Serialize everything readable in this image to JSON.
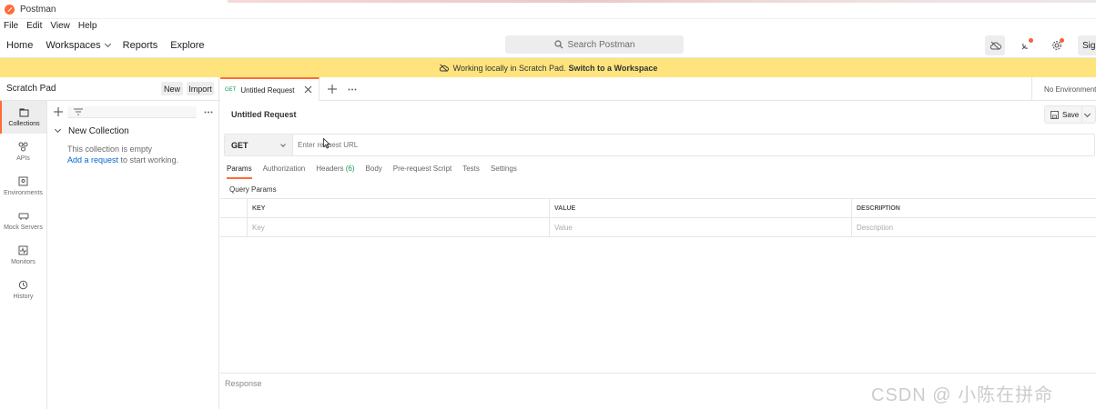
{
  "app": {
    "title": "Postman"
  },
  "menubar": {
    "items": [
      "File",
      "Edit",
      "View",
      "Help"
    ]
  },
  "navbar": {
    "home": "Home",
    "workspaces": "Workspaces",
    "reports": "Reports",
    "explore": "Explore",
    "search_placeholder": "Search Postman",
    "signin": "Sig"
  },
  "banner": {
    "text": "Working locally in Scratch Pad.",
    "link": "Switch to a Workspace"
  },
  "sidebar": {
    "workspace_name": "Scratch Pad",
    "new_label": "New",
    "import_label": "Import",
    "rail": [
      {
        "label": "Collections",
        "icon": "collections-icon"
      },
      {
        "label": "APIs",
        "icon": "apis-icon"
      },
      {
        "label": "Environments",
        "icon": "environments-icon"
      },
      {
        "label": "Mock Servers",
        "icon": "mock-servers-icon"
      },
      {
        "label": "Monitors",
        "icon": "monitors-icon"
      },
      {
        "label": "History",
        "icon": "history-icon"
      }
    ],
    "collection": {
      "name": "New Collection",
      "empty_text": "This collection is empty",
      "add_link": "Add a request",
      "add_suffix": " to start working."
    }
  },
  "tabs": {
    "request_tab": {
      "method": "GET",
      "name": "Untitled Request"
    },
    "environment": "No Environment"
  },
  "request": {
    "title": "Untitled Request",
    "save_label": "Save",
    "method": "GET",
    "url_placeholder": "Enter request URL",
    "subtabs": {
      "params": "Params",
      "authorization": "Authorization",
      "headers": "Headers",
      "headers_count": "(6)",
      "body": "Body",
      "prerequest": "Pre-request Script",
      "tests": "Tests",
      "settings": "Settings"
    },
    "query_params_title": "Query Params",
    "table": {
      "headers": [
        "KEY",
        "VALUE",
        "DESCRIPTION"
      ],
      "placeholders": [
        "Key",
        "Value",
        "Description"
      ]
    }
  },
  "response": {
    "label": "Response"
  },
  "watermark": "CSDN @ 小陈在拼命",
  "colors": {
    "accent": "#ff6c37",
    "banner": "#ffe47e",
    "link": "#0265d2",
    "method_get": "#0f9d58"
  }
}
